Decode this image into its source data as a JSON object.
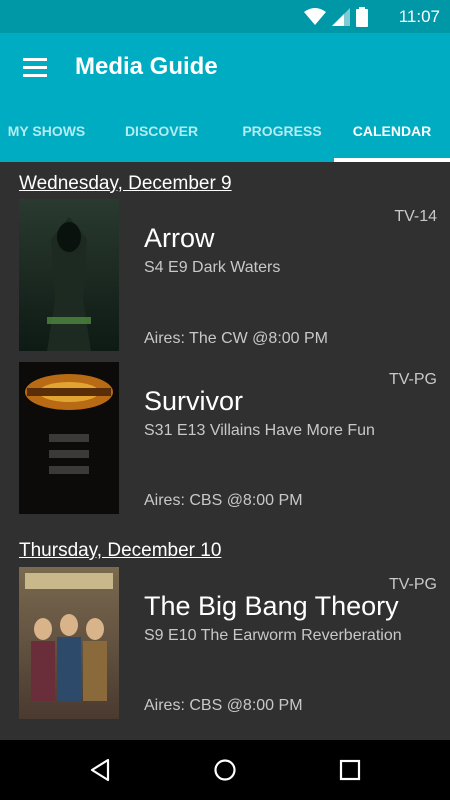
{
  "status_bar": {
    "time": "11:07",
    "icons": [
      "wifi-icon",
      "signal-icon",
      "battery-icon"
    ]
  },
  "app_bar": {
    "title": "Media Guide",
    "menu_icon": "hamburger-menu-icon"
  },
  "tabs": [
    {
      "label": "MY SHOWS",
      "active": false
    },
    {
      "label": "DISCOVER",
      "active": false
    },
    {
      "label": "PROGRESS",
      "active": false
    },
    {
      "label": "CALENDAR",
      "active": true
    }
  ],
  "calendar": {
    "days": [
      {
        "date": "Wednesday, December 9",
        "shows": [
          {
            "title": "Arrow",
            "episode": "S4 E9 Dark Waters",
            "airs": "Aires: The CW @8:00 PM",
            "rating": "TV-14"
          },
          {
            "title": "Survivor",
            "episode": "S31 E13 Villains Have More Fun",
            "airs": "Aires: CBS @8:00 PM",
            "rating": "TV-PG"
          }
        ]
      },
      {
        "date": "Thursday, December 10",
        "shows": [
          {
            "title": "The Big Bang Theory",
            "episode": "S9 E10 The Earworm Reverberation",
            "airs": "Aires: CBS @8:00 PM",
            "rating": "TV-PG"
          }
        ]
      }
    ]
  },
  "nav_bar": {
    "back": "back-icon",
    "home": "home-icon",
    "recents": "recents-icon"
  },
  "colors": {
    "primary_dark": "#0097a7",
    "primary": "#00acc1",
    "background": "#303030"
  }
}
